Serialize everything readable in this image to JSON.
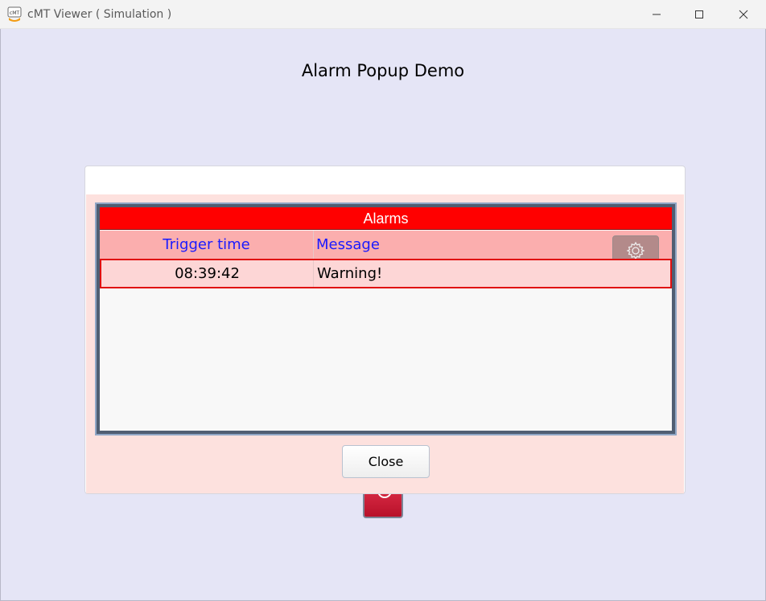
{
  "window": {
    "title": "cMT Viewer ( Simulation )",
    "app_icon": "cmt-app-icon",
    "controls": [
      "minimize-icon",
      "maximize-icon",
      "close-icon"
    ]
  },
  "page": {
    "title": "Alarm Popup Demo",
    "background_color": "#e5e5f6"
  },
  "popup": {
    "alarm_table": {
      "header": "Alarms",
      "header_color": "#ff0000",
      "columns": [
        "Trigger time",
        "Message"
      ],
      "column_text_color": "#1a1aff",
      "settings_icon": "gear-icon",
      "rows": [
        {
          "trigger_time": "08:39:42",
          "message": "Warning!"
        }
      ]
    },
    "close_label": "Close"
  }
}
